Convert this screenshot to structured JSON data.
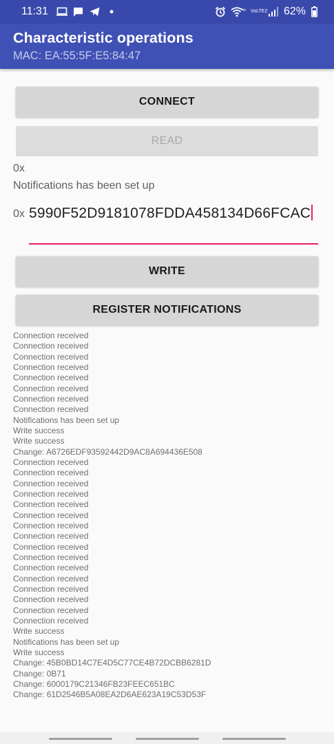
{
  "status_bar": {
    "time": "11:31",
    "battery_percent": "62%",
    "network_label": "VoLTE2",
    "icons_left": [
      "screen-cast-icon",
      "message-icon",
      "telegram-icon",
      "dot-icon"
    ],
    "icons_right": [
      "alarm-icon",
      "wifi-icon",
      "signal-icon",
      "battery-icon"
    ]
  },
  "app_bar": {
    "title": "Characteristic operations",
    "subtitle": "MAC: EA:55:5F:E5:84:47"
  },
  "buttons": {
    "connect": "CONNECT",
    "read": "READ",
    "write": "WRITE",
    "register": "REGISTER NOTIFICATIONS"
  },
  "read_value": "0x",
  "notification_status": "Notifications has been set up",
  "hex_input": {
    "prefix": "0x",
    "value": "5990F52D9181078FDDA458134D66FCAC"
  },
  "log": [
    "Connection received",
    "Connection received",
    "Connection received",
    "Connection received",
    "Connection received",
    "Connection received",
    "Connection received",
    "Connection received",
    "Notifications has been set up",
    "Write success",
    "Write success",
    "Change: A6726EDF93592442D9AC8A694436E508",
    "Connection received",
    "Connection received",
    "Connection received",
    "Connection received",
    "Connection received",
    "Connection received",
    "Connection received",
    "Connection received",
    "Connection received",
    "Connection received",
    "Connection received",
    "Connection received",
    "Connection received",
    "Connection received",
    "Connection received",
    "Connection received",
    "Write success",
    "Notifications has been set up",
    "Write success",
    "Change: 45B0BD14C7E4D5C77CE4B72DCBB6281D",
    "Change: 0B71",
    "Change: 6000179C21346FB23FEEC651BC",
    "Change: 61D2546B5A08EA2D6AE623A19C53D53F"
  ],
  "colors": {
    "status_bar": "#3949ab",
    "app_bar": "#3f51b5",
    "accent": "#e91e63",
    "button": "#d6d6d6",
    "background": "#fafafa"
  }
}
